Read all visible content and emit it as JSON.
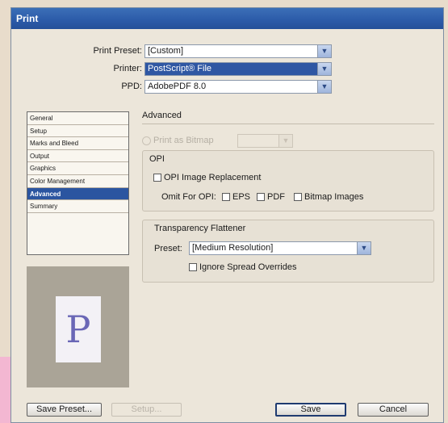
{
  "window": {
    "title": "Print"
  },
  "settings": [
    {
      "label": "Print Preset:",
      "value": "[Custom]"
    },
    {
      "label": "Printer:",
      "value": "PostScript® File"
    },
    {
      "label": "PPD:",
      "value": "AdobePDF 8.0"
    }
  ],
  "categories": [
    "General",
    "Setup",
    "Marks and Bleed",
    "Output",
    "Graphics",
    "Color Management",
    "Advanced",
    "Summary"
  ],
  "selected_category": "Advanced",
  "preview": {
    "page_glyph": "P"
  },
  "advanced": {
    "heading": "Advanced",
    "print_as_bitmap_label": "Print as Bitmap",
    "opi": {
      "title": "OPI",
      "image_replacement_label": "OPI Image Replacement",
      "omit_label": "Omit For OPI:",
      "eps_label": "EPS",
      "pdf_label": "PDF",
      "bitmap_label": "Bitmap Images"
    },
    "flattener": {
      "title": "Transparency Flattener",
      "preset_label": "Preset:",
      "preset_value": "[Medium Resolution]",
      "ignore_label": "Ignore Spread Overrides"
    }
  },
  "buttons": {
    "save_preset": "Save Preset...",
    "setup": "Setup...",
    "save": "Save",
    "cancel": "Cancel"
  },
  "icons": {
    "dropdown": "chevron-down-icon"
  },
  "colors": {
    "title_bar": "#2b5aa8",
    "selection": "#2b55a0",
    "page_glyph": "#6a67b6"
  }
}
